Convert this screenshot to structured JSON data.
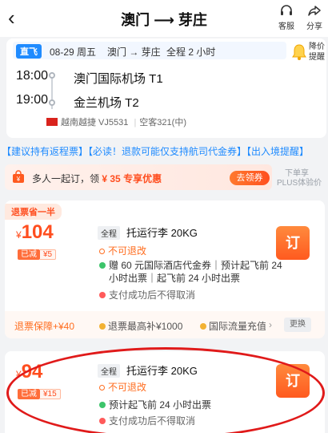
{
  "header": {
    "title": "澳门 ⟶ 芽庄",
    "service_label": "客服",
    "share_label": "分享"
  },
  "flight": {
    "tag": "直飞",
    "date": "08-29 周五",
    "route": "澳门 → 芽庄",
    "duration": "全程 2 小时",
    "notify_label": "降价提醒",
    "dep_time": "18:00",
    "dep_airport": "澳门国际机场 T1",
    "arr_time": "19:00",
    "arr_airport": "金兰机场 T2",
    "airline": "越南越捷 VJ5531",
    "aircraft": "空客321(中)"
  },
  "notice": "【建议持有返程票】【必读！退款可能仅支持航司代金券】【出入境提醒】",
  "promo": {
    "text_prefix": "多人一起订，领",
    "amount": "¥ 35",
    "text_suffix": "专享优惠",
    "button": "去领券",
    "plus_line1": "下单享",
    "plus_line2": "PLUS体验价"
  },
  "fares": [
    {
      "ribbon": "退票省一半",
      "currency": "¥",
      "price": "104",
      "disc_label": "已减",
      "disc_value": "¥5",
      "tag": "全程",
      "baggage": "托运行李 20KG",
      "refund": "不可退改",
      "gift_line1": "赠 60 元国际酒店代金券｜预计起飞前 24",
      "gift_line2": "小时出票｜起飞前 24 小时出票",
      "warn": "支付成功后不得取消",
      "book": "订",
      "footer": {
        "guarantee": "退票保障+¥40",
        "item1": "退票最高补¥1000",
        "item2": "国际流量充值",
        "change": "更换"
      }
    },
    {
      "currency": "¥",
      "price": "94",
      "disc_label": "已减",
      "disc_value": "¥15",
      "tag": "全程",
      "baggage": "托运行李 20KG",
      "refund": "不可退改",
      "ticketing": "预计起飞前 24 小时出票",
      "warn": "支付成功后不得取消",
      "book": "订"
    }
  ],
  "colors": {
    "accent": "#ff4e1f",
    "blue": "#1f8bff",
    "highlight": "#e01a1a"
  }
}
